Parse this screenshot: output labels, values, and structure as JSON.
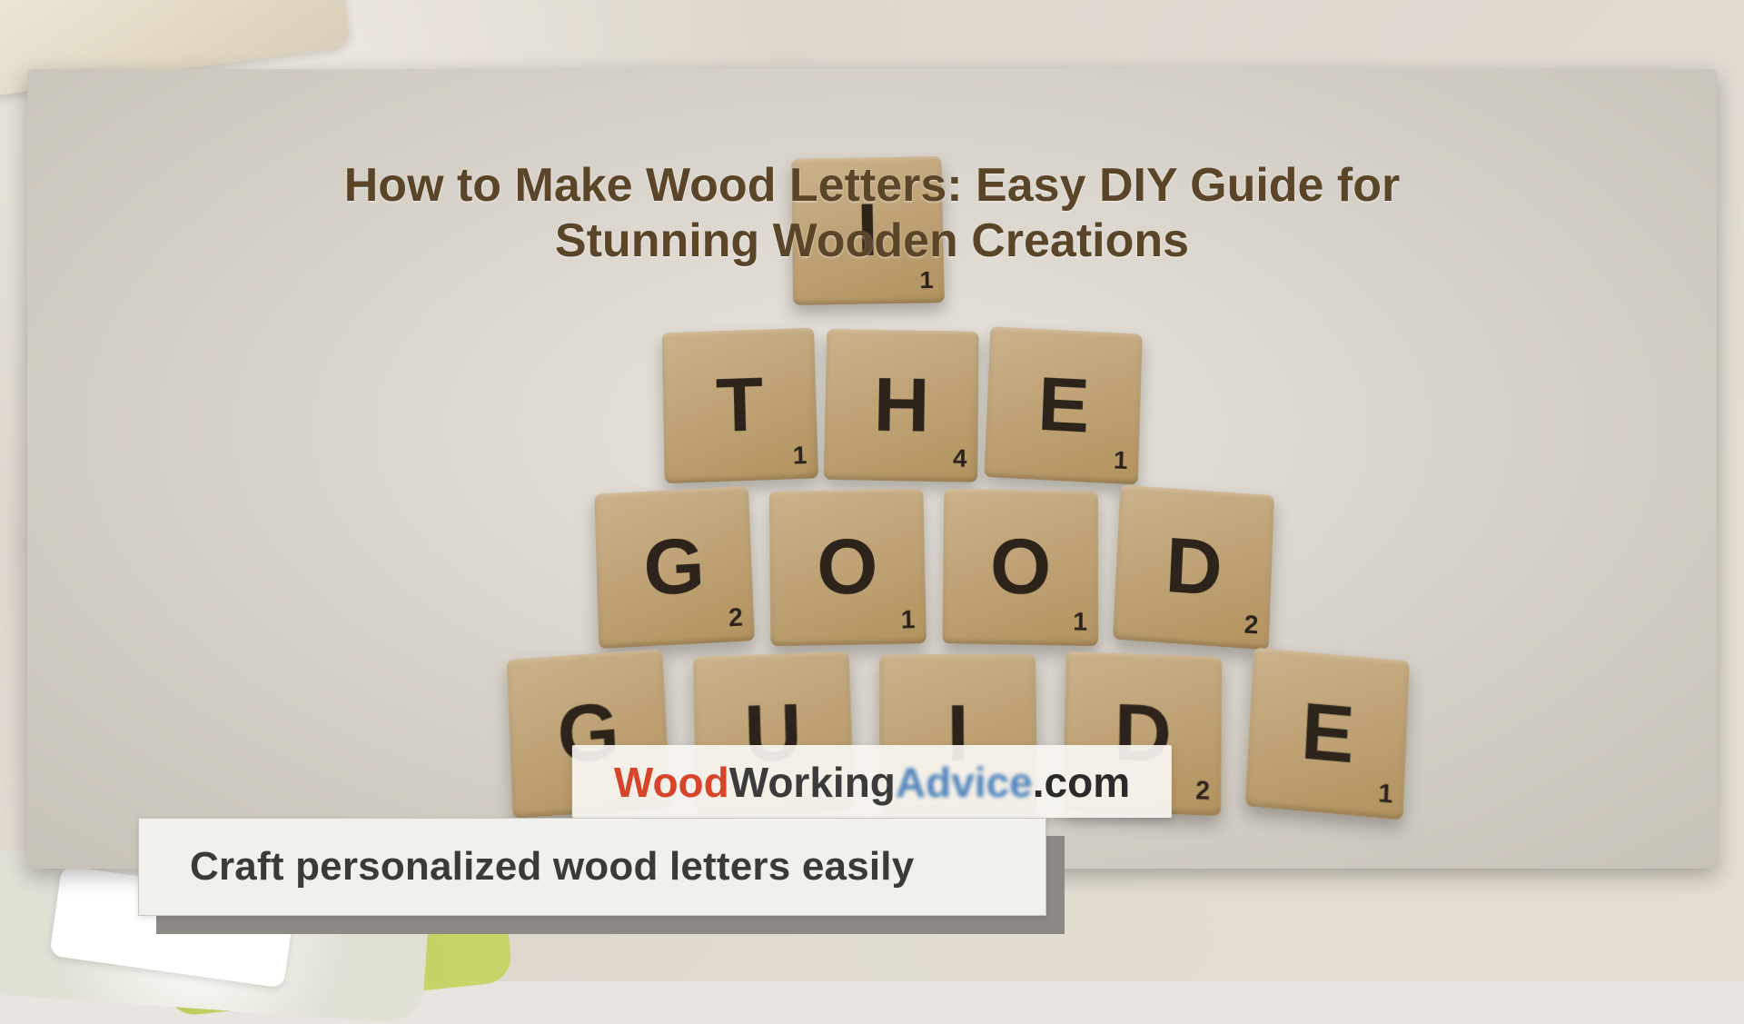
{
  "title_line1": "How to Make Wood Letters: Easy DIY Guide for",
  "title_line2": "Stunning Wooden Creations",
  "watermark": {
    "part1": "Wood",
    "part2": "Working",
    "part3": "Advice",
    "part4": ".com"
  },
  "caption": "Craft personalized wood letters easily",
  "tiles": {
    "row0": [
      {
        "letter": "I",
        "value": "1"
      }
    ],
    "row1": [
      {
        "letter": "T",
        "value": "1"
      },
      {
        "letter": "H",
        "value": "4"
      },
      {
        "letter": "E",
        "value": "1"
      }
    ],
    "row2": [
      {
        "letter": "G",
        "value": "2"
      },
      {
        "letter": "O",
        "value": "1"
      },
      {
        "letter": "O",
        "value": "1"
      },
      {
        "letter": "D",
        "value": "2"
      }
    ],
    "row3": [
      {
        "letter": "G",
        "value": ""
      },
      {
        "letter": "U",
        "value": ""
      },
      {
        "letter": "I",
        "value": ""
      },
      {
        "letter": "D",
        "value": "2"
      },
      {
        "letter": "E",
        "value": "1"
      }
    ]
  }
}
